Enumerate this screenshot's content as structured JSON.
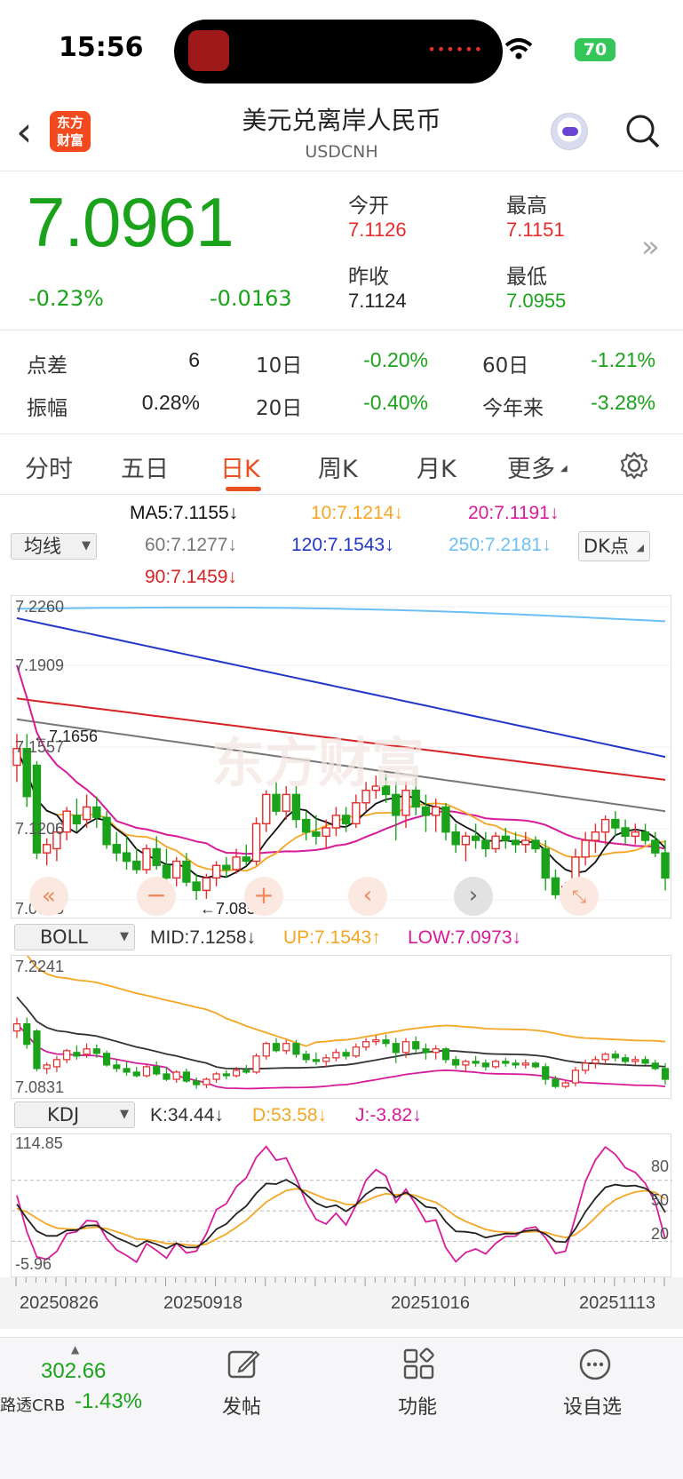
{
  "status": {
    "time": "15:56",
    "battery": "70"
  },
  "header": {
    "logo_line1": "东方",
    "logo_line2": "财富",
    "title": "美元兑离岸人民币",
    "code": "USDCNH"
  },
  "quote": {
    "price": "7.0961",
    "change_pct": "-0.23%",
    "change": "-0.0163",
    "open_label": "今开",
    "open": "7.1126",
    "high_label": "最高",
    "high": "7.1151",
    "prev_close_label": "昨收",
    "prev_close": "7.1124",
    "low_label": "最低",
    "low": "7.0955"
  },
  "stats": [
    {
      "label": "点差",
      "value": "6",
      "color": "black"
    },
    {
      "label": "10日",
      "value": "-0.20%",
      "color": "green"
    },
    {
      "label": "60日",
      "value": "-1.21%",
      "color": "green"
    },
    {
      "label": "振幅",
      "value": "0.28%",
      "color": "black"
    },
    {
      "label": "20日",
      "value": "-0.40%",
      "color": "green"
    },
    {
      "label": "今年来",
      "value": "-3.28%",
      "color": "green"
    }
  ],
  "tabs": [
    "分时",
    "五日",
    "日K",
    "周K",
    "月K",
    "更多"
  ],
  "active_tab": "日K",
  "ma": {
    "selector": "均线",
    "ma5": "MA5:7.1155↓",
    "ma10": "10:7.1214↓",
    "ma20": "20:7.1191↓",
    "ma60": "60:7.1277↓",
    "ma120": "120:7.1543↓",
    "ma250": "250:7.2181↓",
    "ma90": "90:7.1459↓",
    "dk": "DK点"
  },
  "colors": {
    "up": "#e52b2b",
    "down": "#1aa31a",
    "ma5": "#111111",
    "ma10": "#f5a623",
    "ma20": "#d81b9a",
    "ma60": "#777777",
    "ma120": "#2236c8",
    "ma250": "#6cc0f5",
    "ma90": "#d62222"
  },
  "main_chart": {
    "y_labels": [
      "7.2260",
      "7.1909",
      "7.1557",
      "7.1206",
      "7.0855"
    ],
    "max_label": "7.1656",
    "min_label": "7.0855"
  },
  "boll": {
    "selector": "BOLL",
    "mid": "MID:7.1258↓",
    "up": "UP:7.1543↑",
    "low": "LOW:7.0973↓",
    "y_top": "7.2241",
    "y_bottom": "7.0831"
  },
  "kdj": {
    "selector": "KDJ",
    "k": "K:34.44↓",
    "d": "D:53.58↓",
    "j": "J:-3.82↓",
    "y_top": "114.85",
    "y_bottom": "-5.96",
    "levels": [
      "80",
      "50",
      "20"
    ]
  },
  "dates": [
    "20250826",
    "20250918",
    "20251016",
    "20251113"
  ],
  "chart_data": {
    "type": "candlestick",
    "ylim": [
      7.0855,
      7.226
    ],
    "ohlc": [
      [
        7.15,
        7.165,
        7.142,
        7.158
      ],
      [
        7.158,
        7.165,
        7.13,
        7.135
      ],
      [
        7.15,
        7.152,
        7.105,
        7.108
      ],
      [
        7.108,
        7.115,
        7.102,
        7.112
      ],
      [
        7.11,
        7.122,
        7.104,
        7.118
      ],
      [
        7.118,
        7.13,
        7.114,
        7.128
      ],
      [
        7.126,
        7.134,
        7.118,
        7.122
      ],
      [
        7.124,
        7.136,
        7.12,
        7.13
      ],
      [
        7.13,
        7.135,
        7.12,
        7.125
      ],
      [
        7.125,
        7.128,
        7.11,
        7.112
      ],
      [
        7.112,
        7.118,
        7.104,
        7.108
      ],
      [
        7.108,
        7.116,
        7.1,
        7.104
      ],
      [
        7.104,
        7.11,
        7.098,
        7.1
      ],
      [
        7.1,
        7.112,
        7.098,
        7.11
      ],
      [
        7.11,
        7.116,
        7.1,
        7.102
      ],
      [
        7.102,
        7.11,
        7.094,
        7.096
      ],
      [
        7.096,
        7.106,
        7.092,
        7.104
      ],
      [
        7.104,
        7.108,
        7.092,
        7.094
      ],
      [
        7.094,
        7.098,
        7.0855,
        7.09
      ],
      [
        7.09,
        7.098,
        7.086,
        7.096
      ],
      [
        7.096,
        7.104,
        7.092,
        7.102
      ],
      [
        7.102,
        7.106,
        7.096,
        7.1
      ],
      [
        7.1,
        7.11,
        7.098,
        7.106
      ],
      [
        7.106,
        7.112,
        7.102,
        7.104
      ],
      [
        7.104,
        7.125,
        7.102,
        7.122
      ],
      [
        7.122,
        7.138,
        7.118,
        7.136
      ],
      [
        7.136,
        7.142,
        7.126,
        7.128
      ],
      [
        7.128,
        7.14,
        7.124,
        7.136
      ],
      [
        7.136,
        7.14,
        7.12,
        7.124
      ],
      [
        7.124,
        7.128,
        7.114,
        7.118
      ],
      [
        7.118,
        7.126,
        7.112,
        7.116
      ],
      [
        7.116,
        7.124,
        7.11,
        7.12
      ],
      [
        7.12,
        7.13,
        7.116,
        7.126
      ],
      [
        7.126,
        7.13,
        7.118,
        7.122
      ],
      [
        7.122,
        7.136,
        7.12,
        7.132
      ],
      [
        7.132,
        7.142,
        7.128,
        7.138
      ],
      [
        7.138,
        7.145,
        7.134,
        7.14
      ],
      [
        7.14,
        7.146,
        7.132,
        7.136
      ],
      [
        7.136,
        7.142,
        7.114,
        7.126
      ],
      [
        7.126,
        7.142,
        7.12,
        7.138
      ],
      [
        7.138,
        7.144,
        7.126,
        7.13
      ],
      [
        7.13,
        7.136,
        7.118,
        7.126
      ],
      [
        7.126,
        7.134,
        7.118,
        7.13
      ],
      [
        7.13,
        7.132,
        7.114,
        7.118
      ],
      [
        7.118,
        7.122,
        7.108,
        7.112
      ],
      [
        7.112,
        7.118,
        7.104,
        7.116
      ],
      [
        7.116,
        7.122,
        7.11,
        7.114
      ],
      [
        7.114,
        7.118,
        7.106,
        7.11
      ],
      [
        7.11,
        7.118,
        7.108,
        7.116
      ],
      [
        7.116,
        7.12,
        7.11,
        7.114
      ],
      [
        7.114,
        7.118,
        7.108,
        7.112
      ],
      [
        7.112,
        7.118,
        7.108,
        7.114
      ],
      [
        7.114,
        7.116,
        7.108,
        7.11
      ],
      [
        7.11,
        7.114,
        7.09,
        7.096
      ],
      [
        7.096,
        7.1,
        7.086,
        7.088
      ],
      [
        7.088,
        7.094,
        7.086,
        7.092
      ],
      [
        7.092,
        7.11,
        7.088,
        7.106
      ],
      [
        7.106,
        7.118,
        7.102,
        7.114
      ],
      [
        7.114,
        7.122,
        7.108,
        7.118
      ],
      [
        7.118,
        7.126,
        7.112,
        7.124
      ],
      [
        7.124,
        7.128,
        7.116,
        7.12
      ],
      [
        7.12,
        7.124,
        7.112,
        7.116
      ],
      [
        7.116,
        7.122,
        7.112,
        7.118
      ],
      [
        7.118,
        7.122,
        7.112,
        7.114
      ],
      [
        7.114,
        7.118,
        7.106,
        7.108
      ],
      [
        7.108,
        7.114,
        7.09,
        7.096
      ]
    ]
  },
  "bottom": {
    "index_value": "302.66",
    "index_label": "路透CRB",
    "index_change": "-1.43%",
    "post": "发帖",
    "functions": "功能",
    "watchlist": "设自选"
  }
}
